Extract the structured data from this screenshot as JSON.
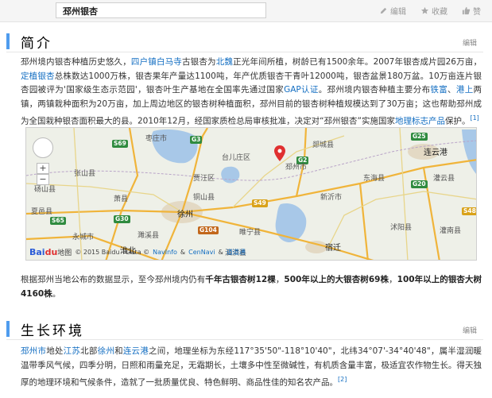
{
  "header": {
    "title": "邳州银杏",
    "actions": [
      "编辑",
      "收藏",
      "赞"
    ]
  },
  "intro": {
    "heading": "简介",
    "edit_label": "编辑",
    "p1": [
      "邳州境内银杏种植历史悠久，",
      "四户镇白马寺",
      "古银杏为",
      "北魏",
      "正光年间所植，树龄已有1500余年。2007年银杏成片园26万亩，",
      "定植",
      "银杏",
      "总株数达1000万株，银杏果年产量达1100吨，年产优质银杏干青叶12000吨，银杏盆景180万盆。10万亩连片银杏园被",
      "评为'国家级生态示范园'，银杏叶生产基地在全国率先通过国家",
      "GAP认证",
      "。邳州境内银杏种植主要分布",
      "铁富",
      "、",
      "港上",
      "两镇，两镇栽",
      "种面积为20万亩，加上周边地区的银杏树种植面积，邳州目前的银杏树种植规模达到了30万亩；这也帮助邳州成为全国栽种银杏",
      "面积最大的县。2010年12月，经国家质检总局审核批准，决定对“邳州银杏”实施国家",
      "地理标志产品",
      "保护。",
      "[1]"
    ],
    "p2": [
      "根据邳州当地公布的数据显示，至今邳州境内仍有",
      "千年古银杏树12棵",
      "，",
      "500年以上的大银杏树69株",
      "，",
      "100年以上的银杏",
      "大树4160株",
      "。"
    ]
  },
  "map": {
    "cities": [
      "台儿庄区",
      "枣庄市",
      "郯城县",
      "邳州市",
      "东海县",
      "连云港",
      "灌云县",
      "徐州",
      "新沂市",
      "沭阳县",
      "灌南县",
      "宿迁",
      "淮北",
      "萧县",
      "砀山县",
      "夏邑县",
      "永城市",
      "濉溪县",
      "铜山县",
      "睢宁县",
      "泗洪县",
      "张山县",
      "贾汪区"
    ],
    "roads": [
      "S69",
      "G3",
      "G25",
      "G2",
      "G30",
      "G104",
      "S65",
      "S49",
      "G20",
      "S48"
    ],
    "footer": [
      "Bai",
      "du",
      "地图",
      "© 2015 Baidu - Data ©",
      "NavInfo",
      "&",
      "CenNavi",
      "&",
      "道道通"
    ]
  },
  "growth": {
    "heading": "生长环境",
    "edit_label": "编辑",
    "p1": [
      "邳州市",
      "地处",
      "江苏",
      "北部",
      "徐州",
      "和",
      "连云港",
      "之间，地理坐标为东经117°35'50\"-118°10'40\"，北纬34°07'-34°40'48\"，属半湿润暖温带",
      "季风气候，四季分明，日照和雨量充足，无霜期长，土壤多中性至微碱性，有机质含量丰富，极适宜农作物生长。得天独厚的地",
      "理环境和气候条件，造就了一批质量优良、特色鲜明、商品性佳的知名农产品。",
      "[2]"
    ]
  }
}
